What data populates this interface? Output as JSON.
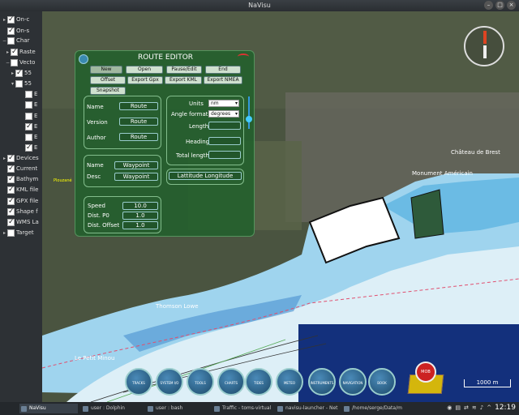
{
  "window": {
    "title": "NaVisu"
  },
  "layers": [
    {
      "label": "On-c",
      "checked": true,
      "twisty": "▸"
    },
    {
      "label": "On-s",
      "checked": true,
      "twisty": ""
    },
    {
      "label": "Char",
      "checked": false,
      "twisty": "−"
    },
    {
      "label": "Raste",
      "checked": true,
      "twisty": "▸"
    },
    {
      "label": "Vecto",
      "checked": false,
      "twisty": "−"
    },
    {
      "label": "55",
      "checked": true,
      "twisty": "▸"
    },
    {
      "label": "55",
      "checked": false,
      "twisty": "▾"
    },
    {
      "label": "E",
      "checked": false,
      "twisty": ""
    },
    {
      "label": "E",
      "checked": false,
      "twisty": ""
    },
    {
      "label": "E",
      "checked": false,
      "twisty": ""
    },
    {
      "label": "E",
      "checked": true,
      "twisty": ""
    },
    {
      "label": "E",
      "checked": false,
      "twisty": ""
    },
    {
      "label": "E",
      "checked": true,
      "twisty": ""
    },
    {
      "label": "Devices",
      "checked": true,
      "twisty": "▸"
    },
    {
      "label": "Current",
      "checked": true,
      "twisty": ""
    },
    {
      "label": "Bathym",
      "checked": true,
      "twisty": ""
    },
    {
      "label": "KML file",
      "checked": true,
      "twisty": ""
    },
    {
      "label": "GPX file",
      "checked": true,
      "twisty": ""
    },
    {
      "label": "Shape f",
      "checked": true,
      "twisty": ""
    },
    {
      "label": "WMS La",
      "checked": true,
      "twisty": ""
    },
    {
      "label": "Target",
      "checked": false,
      "twisty": "▸"
    }
  ],
  "route_editor": {
    "title": "ROUTE EDITOR",
    "buttons_row1": [
      "New",
      "Open",
      "Pause/Edit",
      "End"
    ],
    "buttons_row2": [
      "Offset",
      "Export Gpx",
      "Export KML",
      "Export NMEA"
    ],
    "buttons_row3": [
      "Snapshot"
    ],
    "route": {
      "name_label": "Name",
      "name_value": "Route",
      "version_label": "Version",
      "version_value": "Route",
      "author_label": "Author",
      "author_value": "Route"
    },
    "waypoint": {
      "name_label": "Name",
      "name_value": "Waypoint",
      "desc_label": "Desc",
      "desc_value": "Waypoint"
    },
    "params": {
      "speed_label": "Speed",
      "speed_value": "10.0",
      "dist_p0_label": "Dist. P0",
      "dist_p0_value": "1.0",
      "dist_offset_label": "Dist. Offset",
      "dist_offset_value": "1.0"
    },
    "settings": {
      "units_label": "Units",
      "units_value": "nm",
      "angle_label": "Angle format",
      "angle_value": "degrees",
      "length_label": "Length",
      "heading_label": "Heading",
      "total_label": "Total length"
    },
    "latlon_label": "Lattitude Longitude"
  },
  "map_labels": [
    "Château de Brest",
    "Monument Américain",
    "Thomson Lowe",
    "Le Petit Minou",
    "Plouzané"
  ],
  "toolbar": [
    "TRACKS",
    "SYSTEM I/O",
    "TOOLS",
    "CHARTS",
    "TIDES STREAMS",
    "METEO",
    "INSTRUMENTS",
    "NAVIGATION",
    "BOOK"
  ],
  "mob_label": "MOB",
  "scale_label": "1000 m",
  "taskbar": {
    "tasks": [
      "NaVisu",
      "user : Dolphin",
      "user : bash",
      "Traffic - toms-virtual",
      "navisu-launcher - Net",
      "/home/serge/Data/m"
    ],
    "clock": "12:19"
  },
  "colors": {
    "editor_bg": "#22602c",
    "deep_water": "#1a3a8a",
    "shallow_water": "#7fc8e8"
  }
}
